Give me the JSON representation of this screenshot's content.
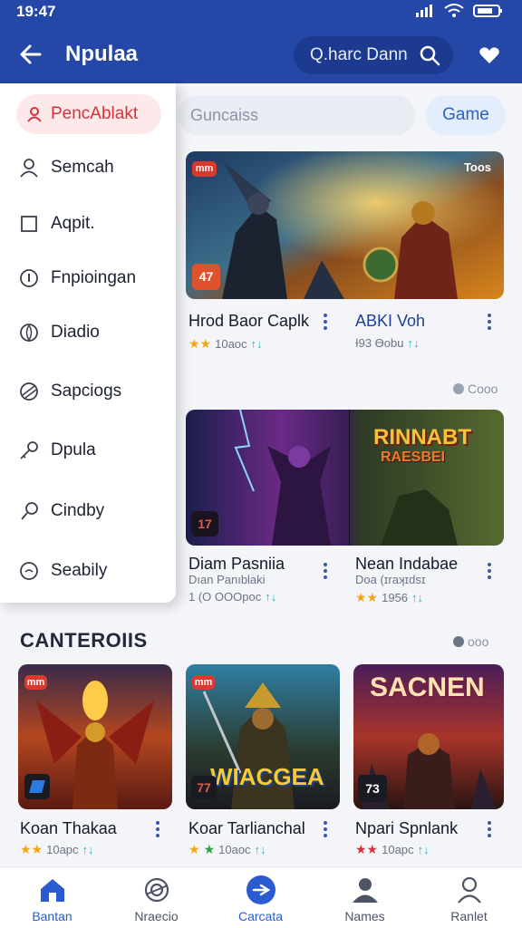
{
  "status": {
    "time": "19:47"
  },
  "appbar": {
    "title": "Npulaa",
    "search_text": "Q.harc Dann"
  },
  "drawer": {
    "items": [
      {
        "label": "PencAblakt",
        "icon": "person-icon"
      },
      {
        "label": "Semcah",
        "icon": "person-outline-icon"
      },
      {
        "label": "Aqpit.",
        "icon": "square-icon"
      },
      {
        "label": "Fnpioingan",
        "icon": "info-circle-icon"
      },
      {
        "label": "Diadio",
        "icon": "leaf-icon"
      },
      {
        "label": "Sapciogs",
        "icon": "ball-icon"
      },
      {
        "label": "Dpula",
        "icon": "key-icon"
      },
      {
        "label": "Cindby",
        "icon": "pin-icon"
      },
      {
        "label": "Seabily",
        "icon": "smile-icon"
      }
    ]
  },
  "filters": {
    "field_placeholder": "Guncaiss",
    "game_label": "Game"
  },
  "featured": [
    {
      "title": "Hrod Baor Caplk",
      "rating": "10аос",
      "badge_top": "mm",
      "badge_bottom": "47"
    },
    {
      "title": "ABKI Voh",
      "rating": "Ɨ93 Ɵobu",
      "badge_top": "Toos"
    }
  ],
  "more_labels": {
    "first": "Cooo",
    "second": "ooo"
  },
  "row2": [
    {
      "title": "Diam Pasniia",
      "subtitle": "Dıan Panıblaki",
      "rating": "1 (О ОООрос",
      "badge_bottom": "17"
    },
    {
      "title": "Nean Indabae",
      "subtitle": "Doa (ɪraʞɪdsɪ",
      "rating": "1956",
      "art_text_1": "RINNABT",
      "art_text_2": "RAESBEI"
    }
  ],
  "section": {
    "title": "CANTEROIIS"
  },
  "row3": [
    {
      "title": "Koan Thakaa",
      "rating": "10арс",
      "badge_top": "mm"
    },
    {
      "title": "Koar Tarlianchal",
      "rating": "10аос",
      "badge_top": "mm",
      "badge_bottom": "77",
      "art_text": "WIACGEA"
    },
    {
      "title": "Npari Spnlank",
      "rating": "10арс",
      "badge_bottom": "73",
      "art_text": "SACNEN"
    }
  ],
  "bottom_nav": [
    {
      "label": "Bantan",
      "icon": "home-icon"
    },
    {
      "label": "Nraecio",
      "icon": "target-icon"
    },
    {
      "label": "Carcata",
      "icon": "compass-icon"
    },
    {
      "label": "Names",
      "icon": "people-icon"
    },
    {
      "label": "Ranlet",
      "icon": "profile-icon"
    }
  ],
  "colors": {
    "primary": "#2447a8",
    "accent_red": "#d5333b",
    "nav_active": "#2a5bd0"
  }
}
